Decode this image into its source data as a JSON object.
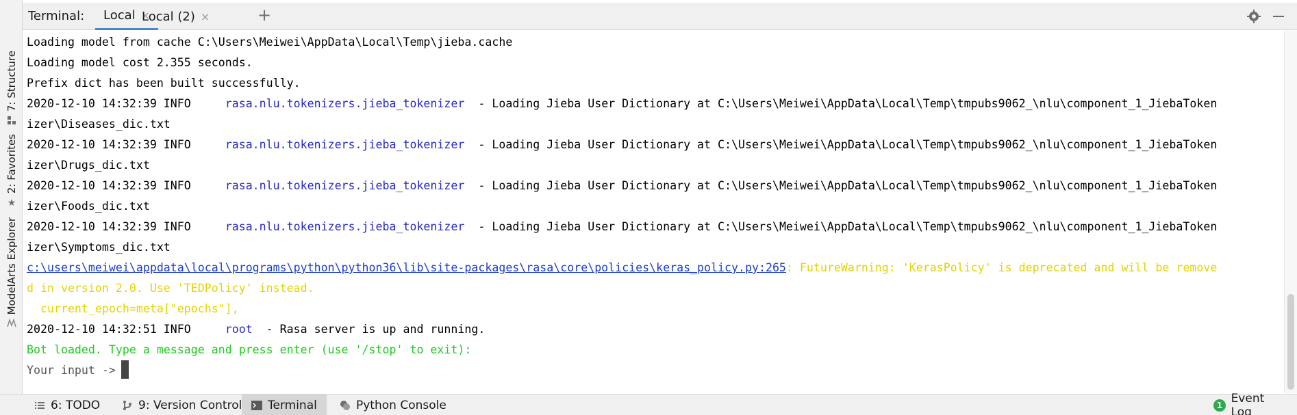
{
  "sidebar": {
    "structure_label": "7: Structure",
    "favorites_label": "2: Favorites",
    "modelarts_label": "ModelArts Explorer"
  },
  "header": {
    "title": "Terminal:",
    "tabs": [
      {
        "label": "Local",
        "active": true
      },
      {
        "label": "Local (2)",
        "active": false
      }
    ],
    "add_tab_label": "+",
    "close_glyph": "×"
  },
  "terminal": {
    "lines": [
      {
        "text": "Loading model from cache C:\\Users\\Meiwei\\AppData\\Local\\Temp\\jieba.cache"
      },
      {
        "text": "Loading model cost 2.355 seconds."
      },
      {
        "text": "Prefix dict has been built successfully."
      },
      {
        "prefix": "2020-12-10 14:32:39 INFO     ",
        "logger": "rasa.nlu.tokenizers.jieba_tokenizer",
        "message": "  - Loading Jieba User Dictionary at C:\\Users\\Meiwei\\AppData\\Local\\Temp\\tmpubs9062_\\nlu\\component_1_JiebaToken"
      },
      {
        "text": "izer\\Diseases_dic.txt"
      },
      {
        "prefix": "2020-12-10 14:32:39 INFO     ",
        "logger": "rasa.nlu.tokenizers.jieba_tokenizer",
        "message": "  - Loading Jieba User Dictionary at C:\\Users\\Meiwei\\AppData\\Local\\Temp\\tmpubs9062_\\nlu\\component_1_JiebaToken"
      },
      {
        "text": "izer\\Drugs_dic.txt"
      },
      {
        "prefix": "2020-12-10 14:32:39 INFO     ",
        "logger": "rasa.nlu.tokenizers.jieba_tokenizer",
        "message": "  - Loading Jieba User Dictionary at C:\\Users\\Meiwei\\AppData\\Local\\Temp\\tmpubs9062_\\nlu\\component_1_JiebaToken"
      },
      {
        "text": "izer\\Foods_dic.txt"
      },
      {
        "prefix": "2020-12-10 14:32:39 INFO     ",
        "logger": "rasa.nlu.tokenizers.jieba_tokenizer",
        "message": "  - Loading Jieba User Dictionary at C:\\Users\\Meiwei\\AppData\\Local\\Temp\\tmpubs9062_\\nlu\\component_1_JiebaToken"
      },
      {
        "text": "izer\\Symptoms_dic.txt"
      },
      {
        "link": "c:\\users\\meiwei\\appdata\\local\\programs\\python\\python36\\lib\\site-packages\\rasa\\core\\policies\\keras_policy.py:265",
        "warning": ": FutureWarning: 'KerasPolicy' is deprecated and will be remove"
      },
      {
        "text": "d in version 2.0. Use 'TEDPolicy' instead."
      },
      {
        "text": "  current_epoch=meta[\"epochs\"],"
      },
      {
        "prefix": "2020-12-10 14:32:51 INFO     ",
        "logger": "root",
        "message": "  - Rasa server is up and running."
      },
      {
        "text": "Bot loaded. Type a message and press enter (use '/stop' to exit):"
      },
      {
        "text": "Your input ->"
      }
    ]
  },
  "bottom": {
    "todo": "6: TODO",
    "version_control": "9: Version Control",
    "terminal": "Terminal",
    "python_console": "Python Console",
    "event_log": "Event Log"
  },
  "colors": {
    "accent": "#4a88c7",
    "link": "#2929c9",
    "warning": "#e6d200",
    "success": "#22cc22",
    "event_log": "#2fa84f"
  },
  "icons": {
    "settings": "gear-icon",
    "minimize": "minimize-icon",
    "structure": "structure-icon",
    "favorites": "star-icon",
    "modelarts": "modelarts-icon",
    "todo": "list-icon",
    "version_control": "branch-icon",
    "terminal": "terminal-icon",
    "python_console": "python-icon",
    "event_log": "event-log-icon"
  }
}
